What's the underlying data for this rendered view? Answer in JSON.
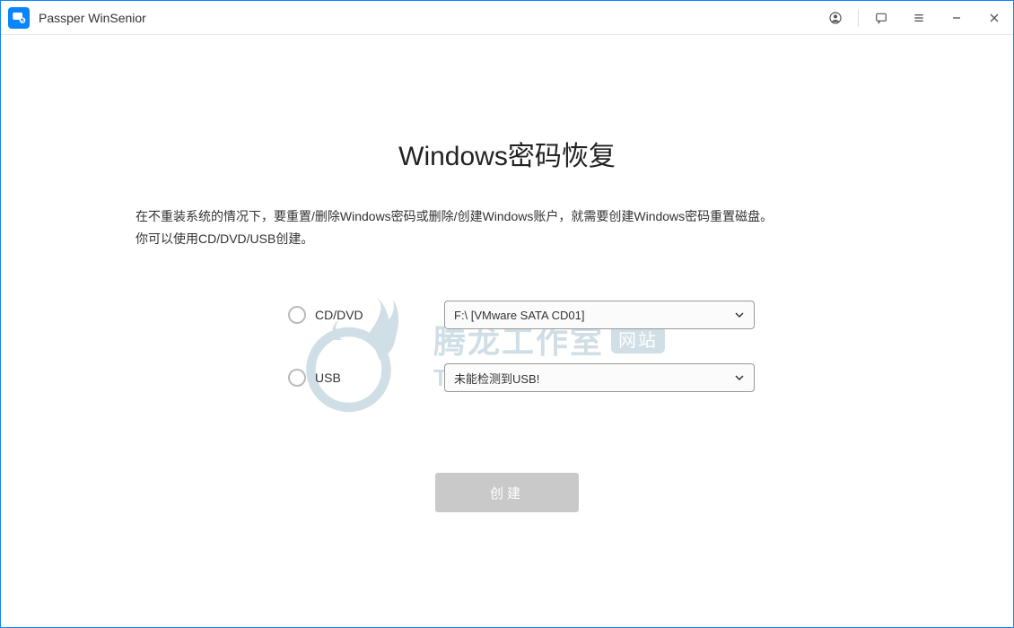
{
  "app": {
    "title": "Passper WinSenior"
  },
  "page": {
    "title": "Windows密码恢复",
    "description_line1": "在不重装系统的情况下，要重置/删除Windows密码或删除/创建Windows账户，就需要创建Windows密码重置磁盘。",
    "description_line2": "你可以使用CD/DVD/USB创建。"
  },
  "options": {
    "cddvd": {
      "label": "CD/DVD",
      "selected": "F:\\ [VMware SATA CD01]"
    },
    "usb": {
      "label": "USB",
      "selected": "未能检测到USB!"
    }
  },
  "action": {
    "create_label": "创建"
  },
  "watermark": {
    "cn": "腾龙工作室",
    "badge": "网站",
    "en": "Tenlonstudio.com"
  }
}
